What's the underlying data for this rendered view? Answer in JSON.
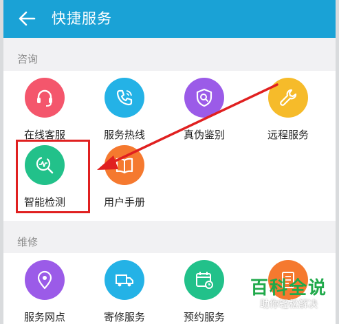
{
  "header": {
    "title": "快捷服务"
  },
  "sections": {
    "consult": {
      "label": "咨询",
      "items": [
        {
          "label": "在线客服",
          "icon": "headset-icon",
          "color": "#f4566c"
        },
        {
          "label": "服务热线",
          "icon": "phone-icon",
          "color": "#24b2e6"
        },
        {
          "label": "真伪鉴别",
          "icon": "shield-search-icon",
          "color": "#9b5be8"
        },
        {
          "label": "远程服务",
          "icon": "wrench-icon",
          "color": "#f6bb2a"
        },
        {
          "label": "智能检测",
          "icon": "diagnostic-icon",
          "color": "#22c18a"
        },
        {
          "label": "用户手册",
          "icon": "book-icon",
          "color": "#f5792f"
        }
      ]
    },
    "repair": {
      "label": "维修",
      "items": [
        {
          "label": "服务网点",
          "icon": "location-pin-icon",
          "color": "#9b5be8"
        },
        {
          "label": "寄修服务",
          "icon": "truck-icon",
          "color": "#24b2e6"
        },
        {
          "label": "预约服务",
          "icon": "calendar-clock-icon",
          "color": "#22c18a"
        },
        {
          "label": "",
          "icon": "document-icon",
          "color": "#f5792f"
        }
      ]
    }
  },
  "annotation": {
    "color": "#e02020"
  },
  "watermark": {
    "title": "百科全说",
    "subtitle": "助你轻松解决"
  }
}
